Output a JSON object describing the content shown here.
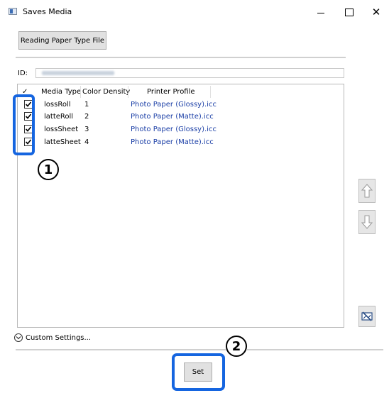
{
  "window": {
    "title": "Saves Media",
    "minimize_glyph": "–",
    "maximize_glyph": "□",
    "close_glyph": "✕"
  },
  "toolbar": {
    "reading_button_label": "Reading Paper Type File"
  },
  "id_section": {
    "label": "ID:",
    "value_obscured": true
  },
  "table": {
    "headers": [
      "Media Type",
      "Color Density",
      "Printer Profile"
    ],
    "rows": [
      {
        "checked": true,
        "media_type": "lossRoll",
        "color_density": "1",
        "printer_profile": "Photo Paper (Glossy).icc"
      },
      {
        "checked": true,
        "media_type": "latteRoll",
        "color_density": "2",
        "printer_profile": "Photo Paper (Matte).icc"
      },
      {
        "checked": true,
        "media_type": "lossSheet",
        "color_density": "3",
        "printer_profile": "Photo Paper (Glossy).icc"
      },
      {
        "checked": true,
        "media_type": "latteSheet",
        "color_density": "4",
        "printer_profile": "Photo Paper (Matte).icc"
      }
    ]
  },
  "side_buttons": {
    "up_icon": "arrow-up-icon",
    "down_icon": "arrow-down-icon",
    "delete_icon": "delete-image-icon"
  },
  "custom_settings": {
    "label": "Custom Settings..."
  },
  "footer": {
    "set_label": "Set"
  },
  "callouts": {
    "one": "1",
    "two": "2"
  },
  "colors": {
    "highlight": "#1565e0",
    "profile_text": "#1a3ea6",
    "button_bg": "#e1e1e1"
  }
}
